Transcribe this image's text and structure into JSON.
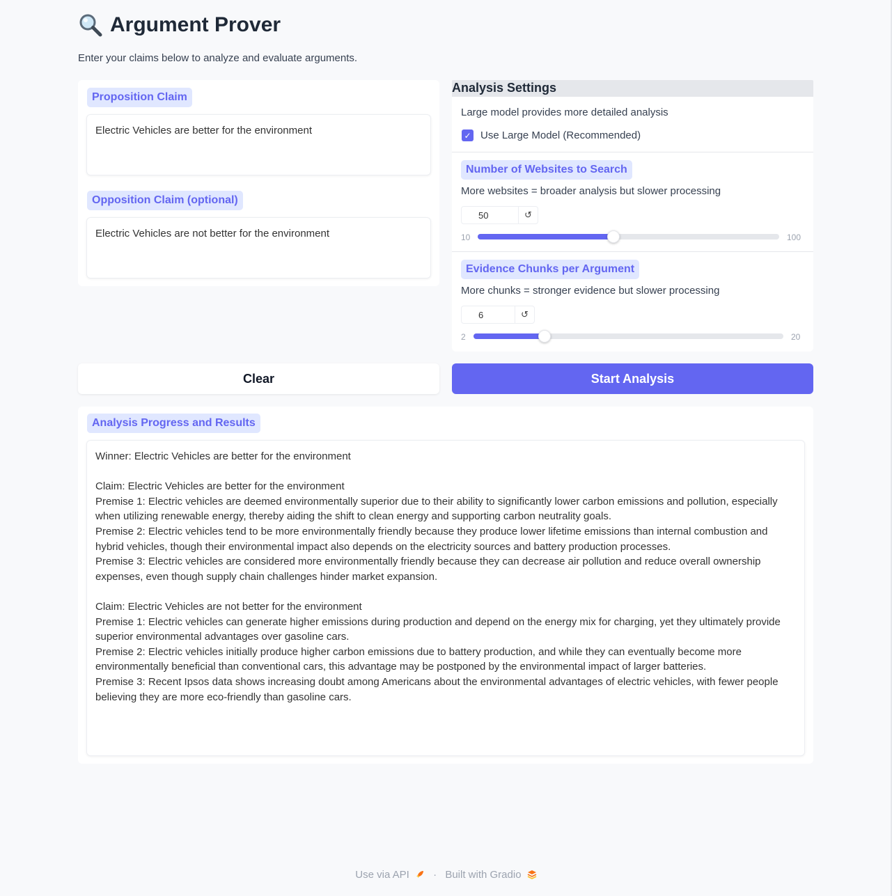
{
  "header": {
    "title": "Argument Prover",
    "subtitle": "Enter your claims below to analyze and evaluate arguments."
  },
  "claims": {
    "proposition_label": "Proposition Claim",
    "proposition_value": "Electric Vehicles are better for the environment",
    "opposition_label": "Opposition Claim (optional)",
    "opposition_value": "Electric Vehicles are not better for the environment"
  },
  "settings": {
    "heading": "Analysis Settings",
    "model_info": "Large model provides more detailed analysis",
    "model_checkbox_label": "Use Large Model (Recommended)",
    "model_checked": true,
    "websites": {
      "label": "Number of Websites to Search",
      "info": "More websites = broader analysis but slower processing",
      "value": "50",
      "min": "10",
      "max": "100"
    },
    "chunks": {
      "label": "Evidence Chunks per Argument",
      "info": "More chunks = stronger evidence but slower processing",
      "value": "6",
      "min": "2",
      "max": "20"
    },
    "reset_glyph": "↺"
  },
  "buttons": {
    "clear": "Clear",
    "start": "Start Analysis"
  },
  "results": {
    "label": "Analysis Progress and Results",
    "winner": "Winner: Electric Vehicles are better for the environment",
    "claim1": "Claim: Electric Vehicles are better for the environment",
    "claim1_p1": "Premise 1: Electric vehicles are deemed environmentally superior due to their ability to significantly lower carbon emissions and pollution, especially when utilizing renewable energy, thereby aiding the shift to clean energy and supporting carbon neutrality goals.",
    "claim1_p2": "Premise 2: Electric vehicles tend to be more environmentally friendly because they produce lower lifetime emissions than internal combustion and hybrid vehicles, though their environmental impact also depends on the electricity sources and battery production processes.",
    "claim1_p3": "Premise 3: Electric vehicles are considered more environmentally friendly because they can decrease air pollution and reduce overall ownership expenses, even though supply chain challenges hinder market expansion.",
    "claim2": "Claim: Electric Vehicles are not better for the environment",
    "claim2_p1": "Premise 1: Electric vehicles can generate higher emissions during production and depend on the energy mix for charging, yet they ultimately provide superior environmental advantages over gasoline cars.",
    "claim2_p2": "Premise 2: Electric vehicles initially produce higher carbon emissions due to battery production, and while they can eventually become more environmentally beneficial than conventional cars, this advantage may be postponed by the environmental impact of larger batteries.",
    "claim2_p3": "Premise 3: Recent Ipsos data shows increasing doubt among Americans about the environmental advantages of electric vehicles, with fewer people believing they are more eco-friendly than gasoline cars."
  },
  "footer": {
    "api": "Use via API",
    "separator": "·",
    "built": "Built with Gradio"
  },
  "colors": {
    "accent": "#6366f1",
    "chip_bg": "#e0e7ff"
  },
  "icons": {
    "title": "magnifying-glass-icon",
    "api": "rocket-icon",
    "gradio": "gradio-logo-icon"
  }
}
